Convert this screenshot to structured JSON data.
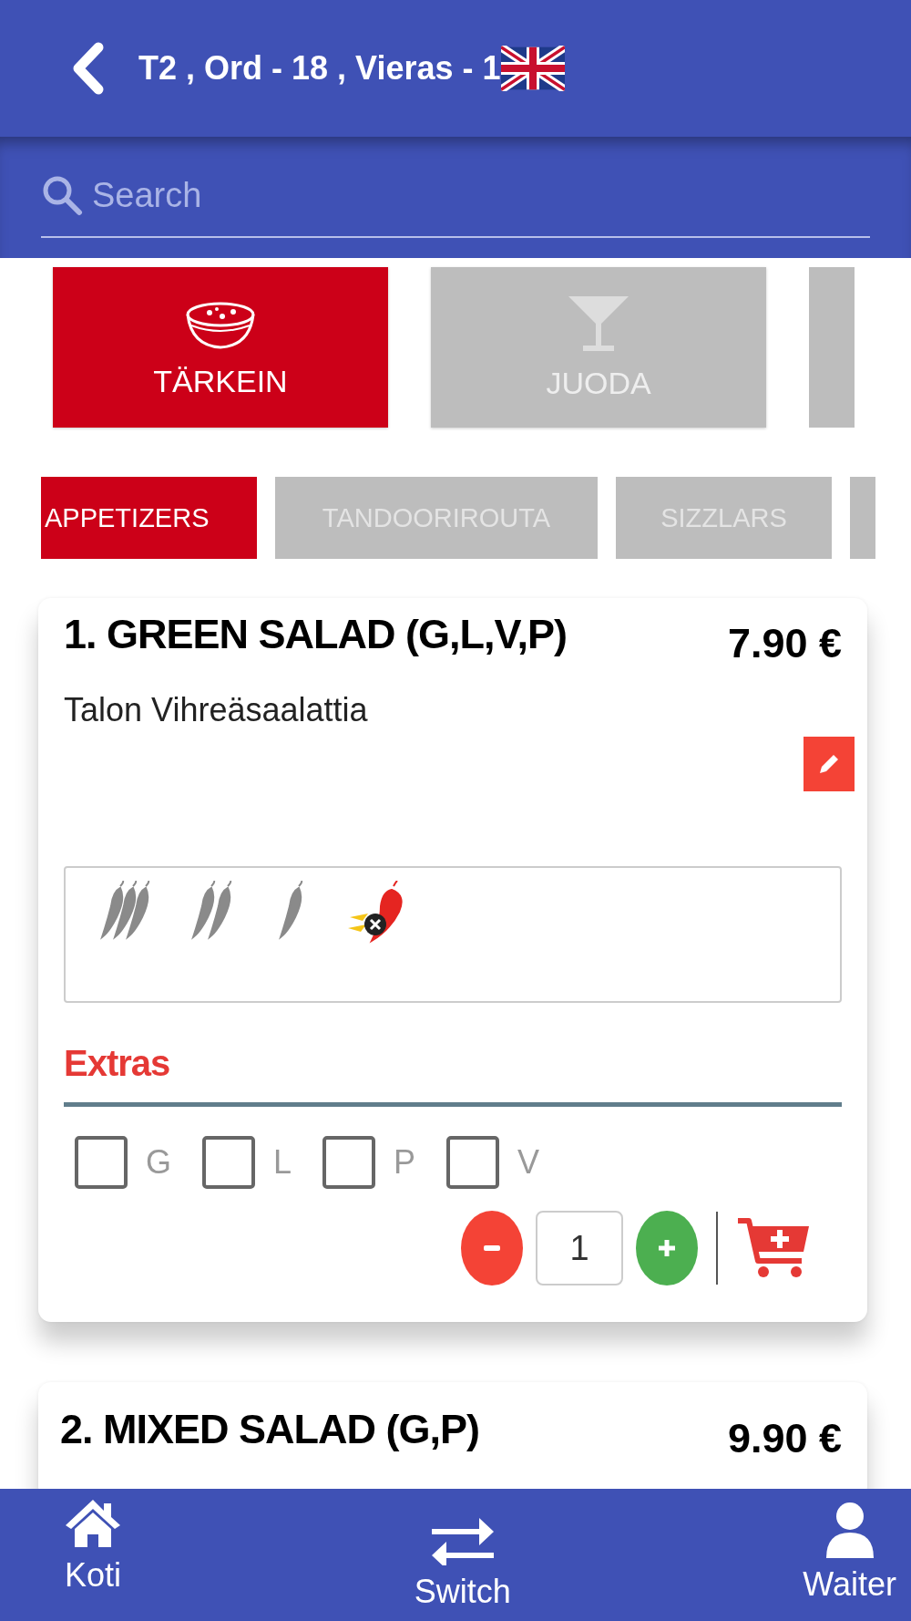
{
  "header": {
    "title": "T2 , Ord - 18 , Vieras - 1"
  },
  "search": {
    "placeholder": "Search"
  },
  "main_categories": [
    {
      "label": "TÄRKEIN",
      "selected": true
    },
    {
      "label": "JUODA",
      "selected": false
    }
  ],
  "sub_categories": [
    {
      "label": "APPETIZERS",
      "selected": true
    },
    {
      "label": "TANDOORIROUTA",
      "selected": false
    },
    {
      "label": "SIZZLARS",
      "selected": false
    }
  ],
  "items": [
    {
      "name": "1. GREEN SALAD (G,L,V,P)",
      "price": "7.90 €",
      "description": "Talon Vihreäsaalattia",
      "spice_options": [
        {
          "kind": "hot"
        },
        {
          "kind": "medium"
        },
        {
          "kind": "mild"
        },
        {
          "kind": "none"
        }
      ],
      "extras_title": "Extras",
      "extras": [
        {
          "label": "G",
          "checked": false
        },
        {
          "label": "L",
          "checked": false
        },
        {
          "label": "P",
          "checked": false
        },
        {
          "label": "V",
          "checked": false
        }
      ],
      "quantity": "1"
    },
    {
      "name": "2. MIXED SALAD (G,P)",
      "price": "9.90 €"
    }
  ],
  "bottom_nav": [
    {
      "label": "Koti"
    },
    {
      "label": "Switch"
    },
    {
      "label": "Waiter"
    }
  ]
}
